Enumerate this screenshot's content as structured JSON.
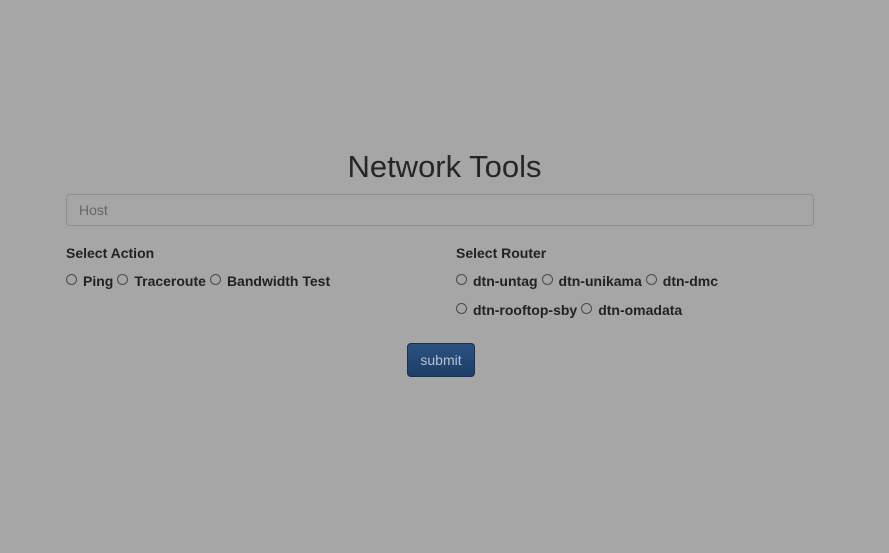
{
  "page": {
    "title": "Network Tools"
  },
  "host": {
    "placeholder": "Host",
    "value": ""
  },
  "action": {
    "label": "Select Action",
    "options": [
      "Ping",
      "Traceroute",
      "Bandwidth Test"
    ]
  },
  "router": {
    "label": "Select Router",
    "options": [
      "dtn-untag",
      "dtn-unikama",
      "dtn-dmc",
      "dtn-rooftop-sby",
      "dtn-omadata"
    ]
  },
  "submit": {
    "label": "submit"
  },
  "colors": {
    "background": "#a6a6a6",
    "button": "#1d3e68",
    "button_text": "#b6c2d2"
  }
}
